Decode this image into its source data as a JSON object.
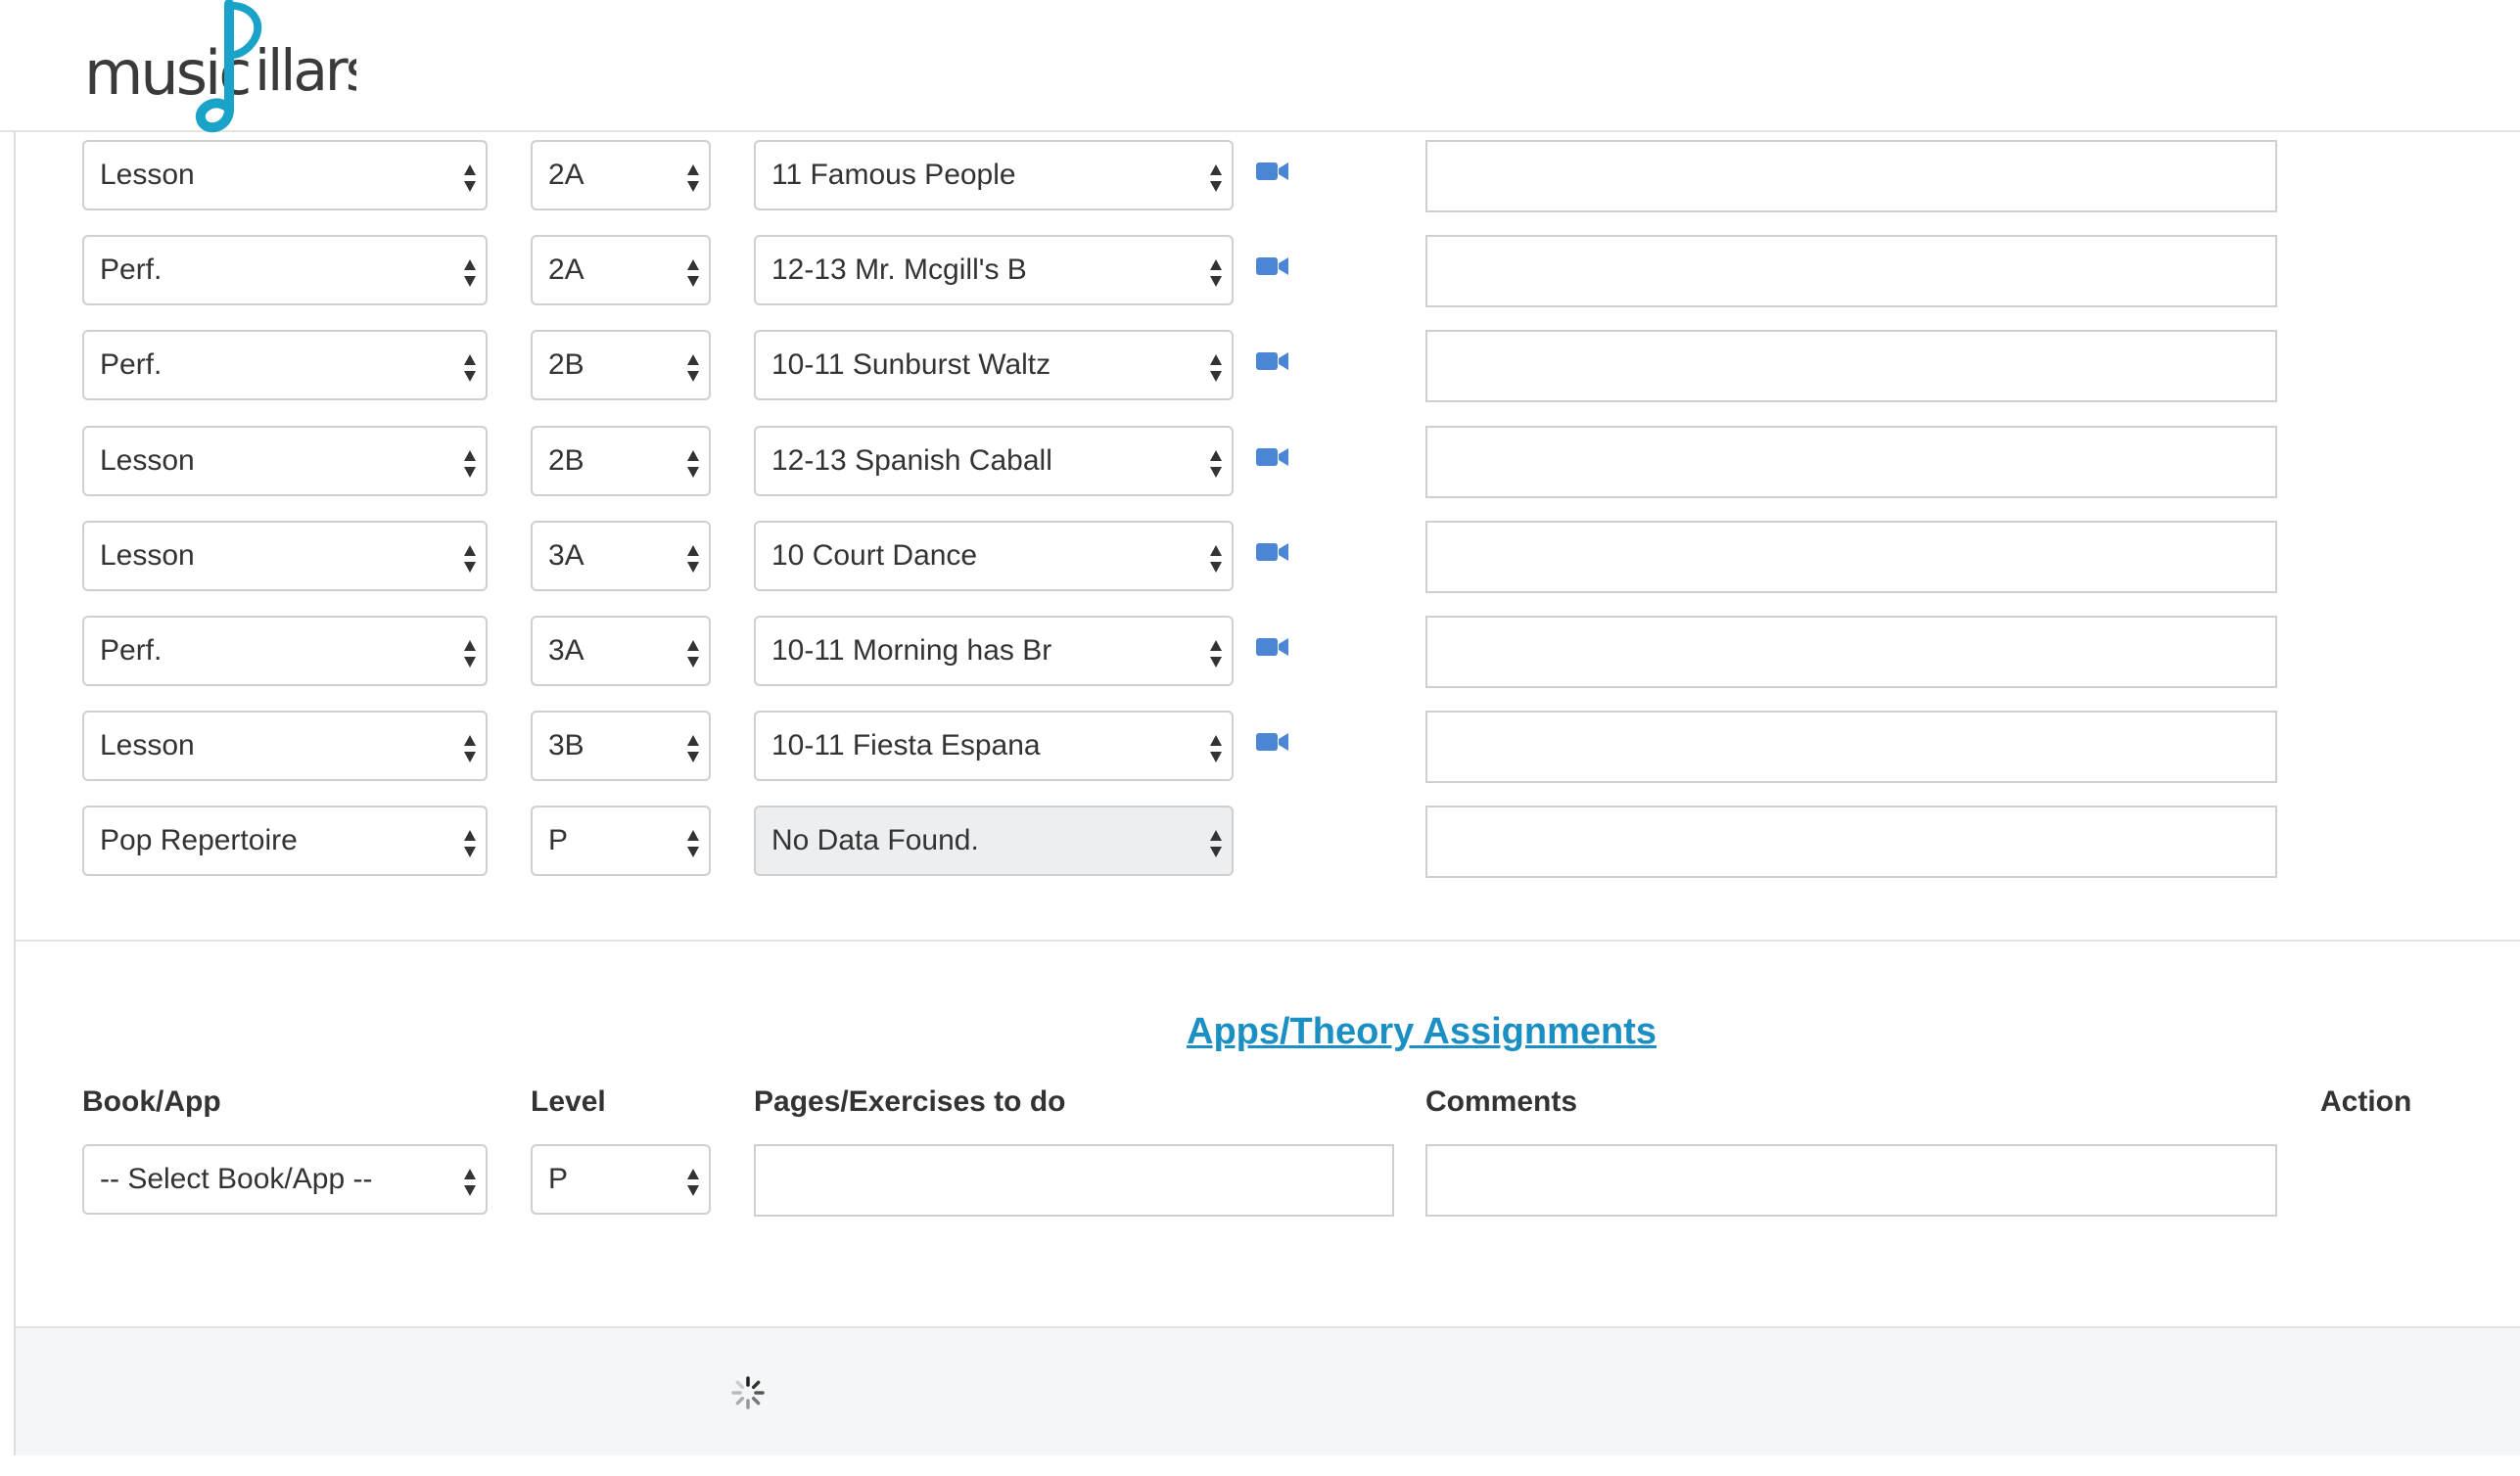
{
  "app": {
    "logo_text": "musicPillars"
  },
  "lesson_rows": [
    {
      "type": "Lesson",
      "level": "2A",
      "piece": "11 Famous People",
      "has_video": true,
      "disabled": false
    },
    {
      "type": "Perf.",
      "level": "2A",
      "piece": "12-13 Mr. Mcgill's B",
      "has_video": true,
      "disabled": false
    },
    {
      "type": "Perf.",
      "level": "2B",
      "piece": "10-11 Sunburst Waltz",
      "has_video": true,
      "disabled": false
    },
    {
      "type": "Lesson",
      "level": "2B",
      "piece": "12-13 Spanish Caball",
      "has_video": true,
      "disabled": false
    },
    {
      "type": "Lesson",
      "level": "3A",
      "piece": "10 Court Dance",
      "has_video": true,
      "disabled": false
    },
    {
      "type": "Perf.",
      "level": "3A",
      "piece": "10-11 Morning has Br",
      "has_video": true,
      "disabled": false
    },
    {
      "type": "Lesson",
      "level": "3B",
      "piece": "10-11 Fiesta Espana",
      "has_video": true,
      "disabled": false
    },
    {
      "type": "Pop Repertoire",
      "level": "P",
      "piece": "No Data Found.",
      "has_video": false,
      "disabled": true
    }
  ],
  "assignments": {
    "title": "Apps/Theory Assignments",
    "headers": {
      "book": "Book/App",
      "level": "Level",
      "pages": "Pages/Exercises to do",
      "comments": "Comments",
      "action": "Action"
    },
    "book_select": "-- Select Book/App --",
    "level_select": "P"
  },
  "colors": {
    "accent": "#1a8fc3",
    "video_icon": "#4a86d4",
    "logo_blue": "#1aa3c8"
  },
  "icons": {
    "video": "video-camera-icon",
    "spinner": "loading-spinner-icon",
    "select_arrows": "sort-arrows-icon"
  }
}
